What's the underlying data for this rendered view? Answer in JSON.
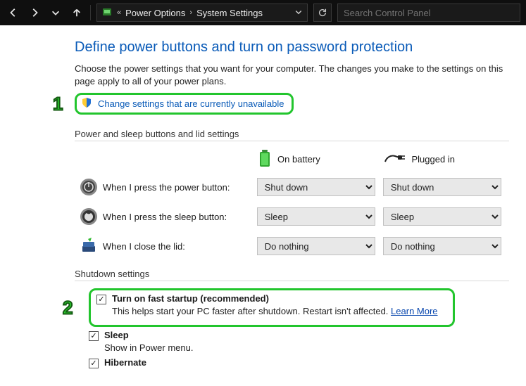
{
  "breadcrumb": {
    "prefix_glyph": "«",
    "item1": "Power Options",
    "item2": "System Settings"
  },
  "search": {
    "placeholder": "Search Control Panel"
  },
  "page": {
    "title": "Define power buttons and turn on password protection",
    "description": "Choose the power settings that you want for your computer. The changes you make to the settings on this page apply to all of your power plans.",
    "change_link": "Change settings that are currently unavailable"
  },
  "section1": {
    "heading": "Power and sleep buttons and lid settings",
    "col_battery": "On battery",
    "col_plugged": "Plugged in",
    "rows": {
      "power": {
        "label": "When I press the power button:",
        "battery": "Shut down",
        "plugged": "Shut down"
      },
      "sleep": {
        "label": "When I press the sleep button:",
        "battery": "Sleep",
        "plugged": "Sleep"
      },
      "lid": {
        "label": "When I close the lid:",
        "battery": "Do nothing",
        "plugged": "Do nothing"
      }
    }
  },
  "section2": {
    "heading": "Shutdown settings",
    "fast_startup": {
      "label": "Turn on fast startup (recommended)",
      "sub": "This helps start your PC faster after shutdown. Restart isn't affected.",
      "learn_more": "Learn More"
    },
    "sleep": {
      "label": "Sleep",
      "sub": "Show in Power menu."
    },
    "hibernate": {
      "label": "Hibernate"
    }
  },
  "annotations": {
    "one": "1",
    "two": "2"
  }
}
